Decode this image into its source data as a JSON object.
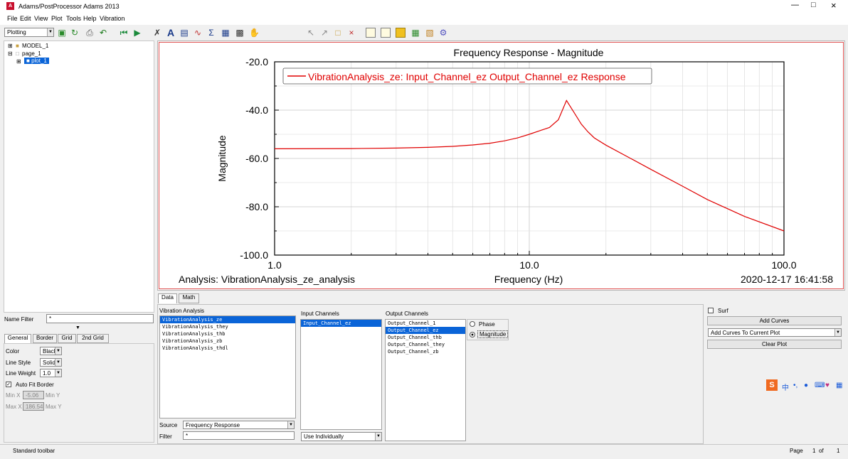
{
  "window": {
    "title": "Adams/PostProcessor Adams 2013",
    "app_icon": "adams-app-icon"
  },
  "menu": [
    "File",
    "Edit",
    "View",
    "Plot",
    "Tools",
    "Help",
    "Vibration"
  ],
  "toolbar": {
    "mode": "Plotting"
  },
  "tree": {
    "model": "MODEL_1",
    "page": "page_1",
    "plot": "plot_1"
  },
  "plot": {
    "title": "Frequency Response - Magnitude",
    "ylabel": "Magnitude",
    "xlabel": "Frequency (Hz)",
    "analysis_label": "Analysis:  VibrationAnalysis_ze_analysis",
    "timestamp": "2020-12-17 16:41:58",
    "legend": "VibrationAnalysis_ze: Input_Channel_ez Output_Channel_ez Response",
    "x_ticks": [
      "1.0",
      "10.0",
      "100.0"
    ],
    "y_ticks": [
      "-20.0",
      "-40.0",
      "-60.0",
      "-80.0",
      "-100.0"
    ]
  },
  "chart_data": {
    "type": "line",
    "title": "Frequency Response - Magnitude",
    "xlabel": "Frequency (Hz)",
    "ylabel": "Magnitude",
    "xscale": "log",
    "xlim": [
      1,
      100
    ],
    "ylim": [
      -100,
      -20
    ],
    "grid": true,
    "legend_position": "top-left",
    "series": [
      {
        "name": "VibrationAnalysis_ze: Input_Channel_ez Output_Channel_ez Response",
        "color": "#e00000",
        "x": [
          1,
          2,
          3,
          4,
          5,
          6,
          7,
          8,
          9,
          10,
          11,
          12,
          13,
          14,
          15,
          16,
          17,
          18,
          20,
          25,
          30,
          40,
          50,
          70,
          100
        ],
        "y": [
          -56,
          -55.9,
          -55.7,
          -55.4,
          -55,
          -54.4,
          -53.7,
          -52.7,
          -51.5,
          -50,
          -48.5,
          -47.2,
          -44,
          -36,
          -41,
          -45.8,
          -49,
          -51.5,
          -54.5,
          -60,
          -64.5,
          -71.5,
          -77,
          -84,
          -90
        ]
      }
    ]
  },
  "name_filter": {
    "label": "Name Filter",
    "value": "*"
  },
  "props_tabs": [
    "General",
    "Border",
    "Grid",
    "2nd Grid"
  ],
  "props": {
    "color_label": "Color",
    "color_value": "Black",
    "style_label": "Line Style",
    "style_value": "Solid",
    "weight_label": "Line Weight",
    "weight_value": "1.0",
    "autofit_label": "Auto Fit Border",
    "minx_label": "Min X",
    "minx_value": "-5.06",
    "miny_label": "Min Y",
    "maxx_label": "Max X",
    "maxx_value": "186.54",
    "maxy_label": "Max Y"
  },
  "data_tabs": [
    "Data",
    "Math"
  ],
  "vibration": {
    "label": "Vibration Analysis",
    "items": [
      "VibrationAnalysis_ze",
      "VibrationAnalysis_they",
      "VibrationAnalysis_thb",
      "VibrationAnalysis_zb",
      "VibrationAnalysis_thdl"
    ],
    "source_label": "Source",
    "source_value": "Frequency Response",
    "filter_label": "Filter",
    "filter_value": "*"
  },
  "input_channels": {
    "label": "Input Channels",
    "items": [
      "Input_Channel_ez"
    ],
    "mode": "Use Individually"
  },
  "output_channels": {
    "label": "Output Channels",
    "items": [
      "Output_Channel_1",
      "Output_Channel_ez",
      "Output_Channel_thb",
      "Output_Channel_they",
      "Output_Channel_zb"
    ]
  },
  "response": {
    "phase": "Phase",
    "magnitude": "Magnitude"
  },
  "actions": {
    "surf": "Surf",
    "add_curves": "Add Curves",
    "add_mode": "Add Curves To Current Plot",
    "clear": "Clear Plot"
  },
  "ime": {
    "text": "中"
  },
  "status": {
    "left": "Standard toolbar",
    "page_label": "Page",
    "page_num": "1",
    "of": "of",
    "total": "1"
  }
}
